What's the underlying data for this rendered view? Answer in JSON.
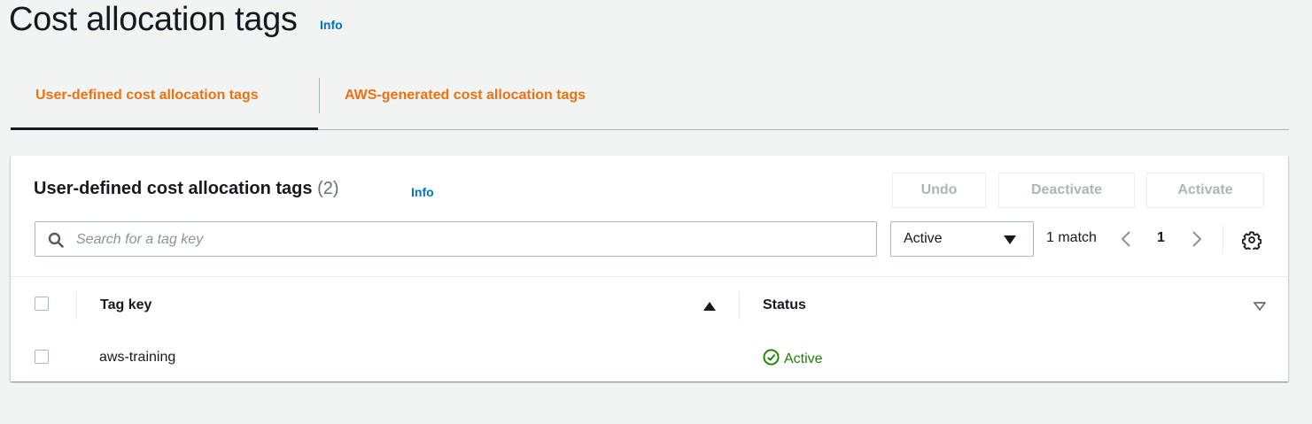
{
  "page": {
    "title": "Cost allocation tags",
    "info_label": "Info"
  },
  "tabs": [
    {
      "label": "User-defined cost allocation tags",
      "selected": true
    },
    {
      "label": "AWS-generated cost allocation tags",
      "selected": false
    }
  ],
  "table_panel": {
    "title": "User-defined cost allocation tags",
    "count": "(2)",
    "info_label": "Info",
    "buttons": {
      "undo": "Undo",
      "deactivate": "Deactivate",
      "activate": "Activate"
    },
    "search": {
      "placeholder": "Search for a tag key",
      "value": ""
    },
    "status_filter": {
      "selected": "Active"
    },
    "match_count": "1 match",
    "pagination": {
      "current_page": "1"
    },
    "columns": {
      "tag_key": "Tag key",
      "status": "Status"
    },
    "rows": [
      {
        "tag_key": "aws-training",
        "status": "Active"
      }
    ]
  },
  "colors": {
    "accent_orange": "#ec7211",
    "link_blue": "#0073bb",
    "status_green": "#1d8102",
    "disabled_gray": "#aab7b8"
  },
  "icons": [
    "search-icon",
    "caret-down-icon",
    "chevron-left-icon",
    "chevron-right-icon",
    "gear-icon",
    "sort-ascending-icon",
    "sort-descending-icon",
    "check-circle-icon"
  ]
}
